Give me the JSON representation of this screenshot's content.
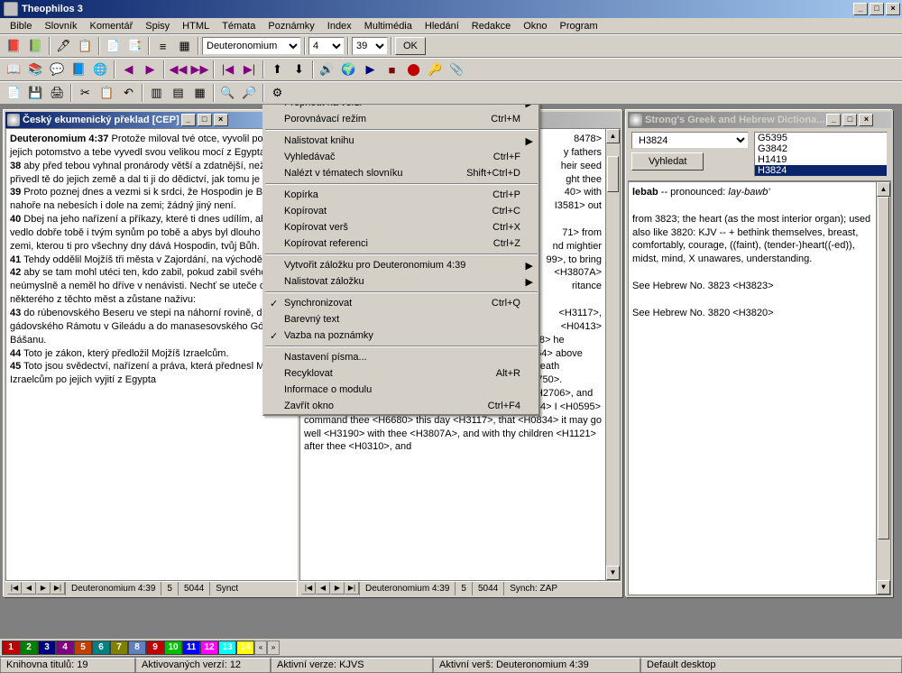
{
  "app_title": "Theophilos 3",
  "menu": [
    "Bible",
    "Slovník",
    "Komentář",
    "Spisy",
    "HTML",
    "Témata",
    "Poznámky",
    "Index",
    "Multimédia",
    "Hledání",
    "Redakce",
    "Okno",
    "Program"
  ],
  "nav": {
    "book": "Deuteronomium",
    "chapter": "4",
    "verse": "39",
    "ok": "OK"
  },
  "panes": {
    "left": {
      "title": "Český ekumenický překlad [CEP]",
      "ref": "Deuteronomium 4:37",
      "text37": " Protože miloval tvé otce, vyvolil po nich i jejich potomstvo a tebe vyvedl svou velikou mocí z Egypta,",
      "v38": "38",
      "t38": " aby před tebou vyhnal pronárody větší a zdatnější, než jsi ty, a přivedl tě do jejich země a dal ti ji do dědictví, jak tomu je dnes.",
      "v39": "39",
      "t39": " Proto poznej dnes a vezmi si k srdci, že Hospodin je Bůh nahoře na nebesích i dole na zemi; žádný jiný není.",
      "v40": "40",
      "t40": " Dbej na jeho nařízení a příkazy, které ti dnes udílím, aby se vedlo dobře tobě i tvým synům po tobě a abys byl dlouho živ na zemi, kterou ti pro všechny dny dává Hospodin, tvůj Bůh.",
      "v41": "41",
      "t41": " Tehdy oddělil Mojžíš tři města v Zajordání, na východě,",
      "v42": "42",
      "t42": " aby se tam mohl utéci ten, kdo zabil, pokud zabil svého bližního neúmyslně a neměl ho dříve v nenávisti. Nechť se uteče do některého z těchto měst a zůstane naživu:",
      "v43": "43",
      "t43": " do rúbenovského Beseru ve stepi na náhorní rovině, do gádovského Rámotu v Gileádu a do manasesovského Gólanu v Bášanu.",
      "v44": "44",
      "t44": " Toto je zákon, který předložil Mojžíš Izraelcům.",
      "v45": "45",
      "t45": " Toto jsou svědectví, nařízení a práva, která přednesl Mojžíš Izraelcům po jejich vyjití z Egypta",
      "status": {
        "ref": "Deuteronomium 4:39",
        "ch": "5",
        "vn": "5044",
        "sync": "Synct"
      }
    },
    "mid": {
      "frag1": "8478>",
      "frag2": "y fathers",
      "frag3": "heir seed",
      "frag4": "ght thee",
      "frag5": "40> with",
      "frag6": "I3581> out",
      "frag7": "71> from",
      "frag8": "nd mightier",
      "frag9": "99>, to bring",
      "frag10": "<H3807A>",
      "frag11": "ritance",
      "line12": "<H3117>,",
      "line13": "<H0413>",
      "line14": "thine heart <H3824>, that <H3588> the LORD <H3068> he <H1931> is <H9999> God <H0430> in heaven <H8064> above <H4605>, and upon <H5921> the earth <H0776> beneath <H8478>: there is <H9999> none <H0369> else <H5750>.",
      "v40": "40",
      "t40": " Thou shalt keep therefore <H8104> his statutes <H2706>, and <H0853> his commandments <H4687>, which <H0834> I <H0595> command thee <H6680> this day <H3117>, that <H0834> it may go well <H3190> with thee <H3807A>, and with thy children <H1121> after thee <H0310>, and",
      "status": {
        "ref": "Deuteronomium 4:39",
        "ch": "5",
        "vn": "5044",
        "sync": "Synch: ZAP"
      }
    },
    "right": {
      "title": "Strong's Greek and Hebrew Dictiona...",
      "input": "H3824",
      "button": "Vyhledat",
      "list": [
        "G5395",
        "G3842",
        "H1419",
        "H3824"
      ],
      "head": "lebab",
      "pron": " -- pronounced: ",
      "pron_i": "lay-bawb'",
      "def": "from 3823; the heart (as the most interior organ); used also like 3820: KJV -- + bethink themselves, breast, comfortably, courage, ((faint), (tender-)heart((-ed)), midst, mind, X unawares, understanding.",
      "see1": "See Hebrew No. 3823 <H3823>",
      "see2": "See Hebrew No. 3820 <H3820>"
    }
  },
  "ctx": [
    {
      "lbl": "Přepnout na verzi",
      "sub": true
    },
    {
      "lbl": "Porovnávací režim",
      "sc": "Ctrl+M"
    },
    {
      "sep": true
    },
    {
      "lbl": "Nalistovat knihu",
      "sub": true
    },
    {
      "lbl": "Vyhledávač",
      "sc": "Ctrl+F"
    },
    {
      "lbl": "Nalézt v tématech slovníku",
      "sc": "Shift+Ctrl+D"
    },
    {
      "sep": true
    },
    {
      "lbl": "Kopírka",
      "sc": "Ctrl+P"
    },
    {
      "lbl": "Kopírovat",
      "sc": "Ctrl+C"
    },
    {
      "lbl": "Kopírovat verš",
      "sc": "Ctrl+X"
    },
    {
      "lbl": "Kopírovat referenci",
      "sc": "Ctrl+Z"
    },
    {
      "sep": true
    },
    {
      "lbl": "Vytvořit záložku pro Deuteronomium 4:39",
      "sub": true
    },
    {
      "lbl": "Nalistovat záložku",
      "sub": true
    },
    {
      "sep": true
    },
    {
      "lbl": "Synchronizovat",
      "sc": "Ctrl+Q",
      "chk": true
    },
    {
      "lbl": "Barevný text"
    },
    {
      "lbl": "Vazba na poznámky",
      "chk": true
    },
    {
      "sep": true
    },
    {
      "lbl": "Nastavení písma..."
    },
    {
      "lbl": "Recyklovat",
      "sc": "Alt+R"
    },
    {
      "lbl": "Informace o modulu"
    },
    {
      "lbl": "Zavřít okno",
      "sc": "Ctrl+F4"
    }
  ],
  "tabs": {
    "colors": [
      "#c00000",
      "#008000",
      "#000080",
      "#800080",
      "#c04000",
      "#008080",
      "#808000",
      "#6080c0",
      "#c00000",
      "#00c000",
      "#0000ff",
      "#ff00ff",
      "#00ffff",
      "#ffff00"
    ],
    "arrows": [
      "«",
      "»"
    ]
  },
  "status": {
    "lib": "Knihovna titulů: 19",
    "act": "Aktivovaných verzí: 12",
    "ver": "Aktivní verze: KJVS",
    "verse": "Aktivní verš: Deuteronomium 4:39",
    "desk": "Default desktop"
  }
}
